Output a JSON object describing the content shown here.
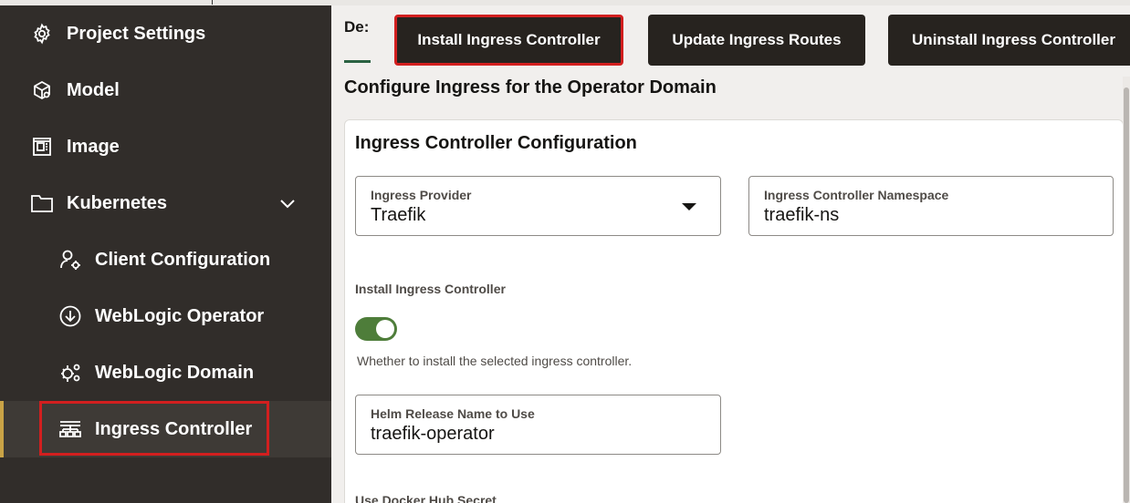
{
  "sidebar": {
    "items": [
      {
        "label": "Project Settings",
        "icon": "gear-icon"
      },
      {
        "label": "Model",
        "icon": "model-icon"
      },
      {
        "label": "Image",
        "icon": "image-icon"
      },
      {
        "label": "Kubernetes",
        "icon": "folder-icon",
        "expanded": true
      },
      {
        "label": "Client Configuration",
        "icon": "user-settings-icon"
      },
      {
        "label": "WebLogic Operator",
        "icon": "download-circle-icon"
      },
      {
        "label": "WebLogic Domain",
        "icon": "domain-icon"
      },
      {
        "label": "Ingress Controller",
        "icon": "ingress-icon",
        "active": true
      }
    ]
  },
  "toolbar": {
    "tab_label": "De:",
    "install_label": "Install Ingress Controller",
    "update_label": "Update Ingress Routes",
    "uninstall_label": "Uninstall Ingress Controller"
  },
  "main": {
    "heading": "Configure Ingress for the Operator Domain",
    "card": {
      "title": "Ingress Controller Configuration",
      "provider": {
        "label": "Ingress Provider",
        "value": "Traefik"
      },
      "namespace": {
        "label": "Ingress Controller Namespace",
        "value": "traefik-ns"
      },
      "install": {
        "label": "Install Ingress Controller",
        "enabled": true,
        "help": "Whether to install the selected ingress controller."
      },
      "helm_release": {
        "label": "Helm Release Name to Use",
        "value": "traefik-operator"
      },
      "next_label_partial": "Use Docker Hub Secret"
    }
  },
  "colors": {
    "sidebar_bg": "#312d2a",
    "active_accent": "#c9a346",
    "highlight_red": "#d21f1f",
    "toggle_on": "#4e7d3a",
    "button_bg": "#27231f"
  }
}
